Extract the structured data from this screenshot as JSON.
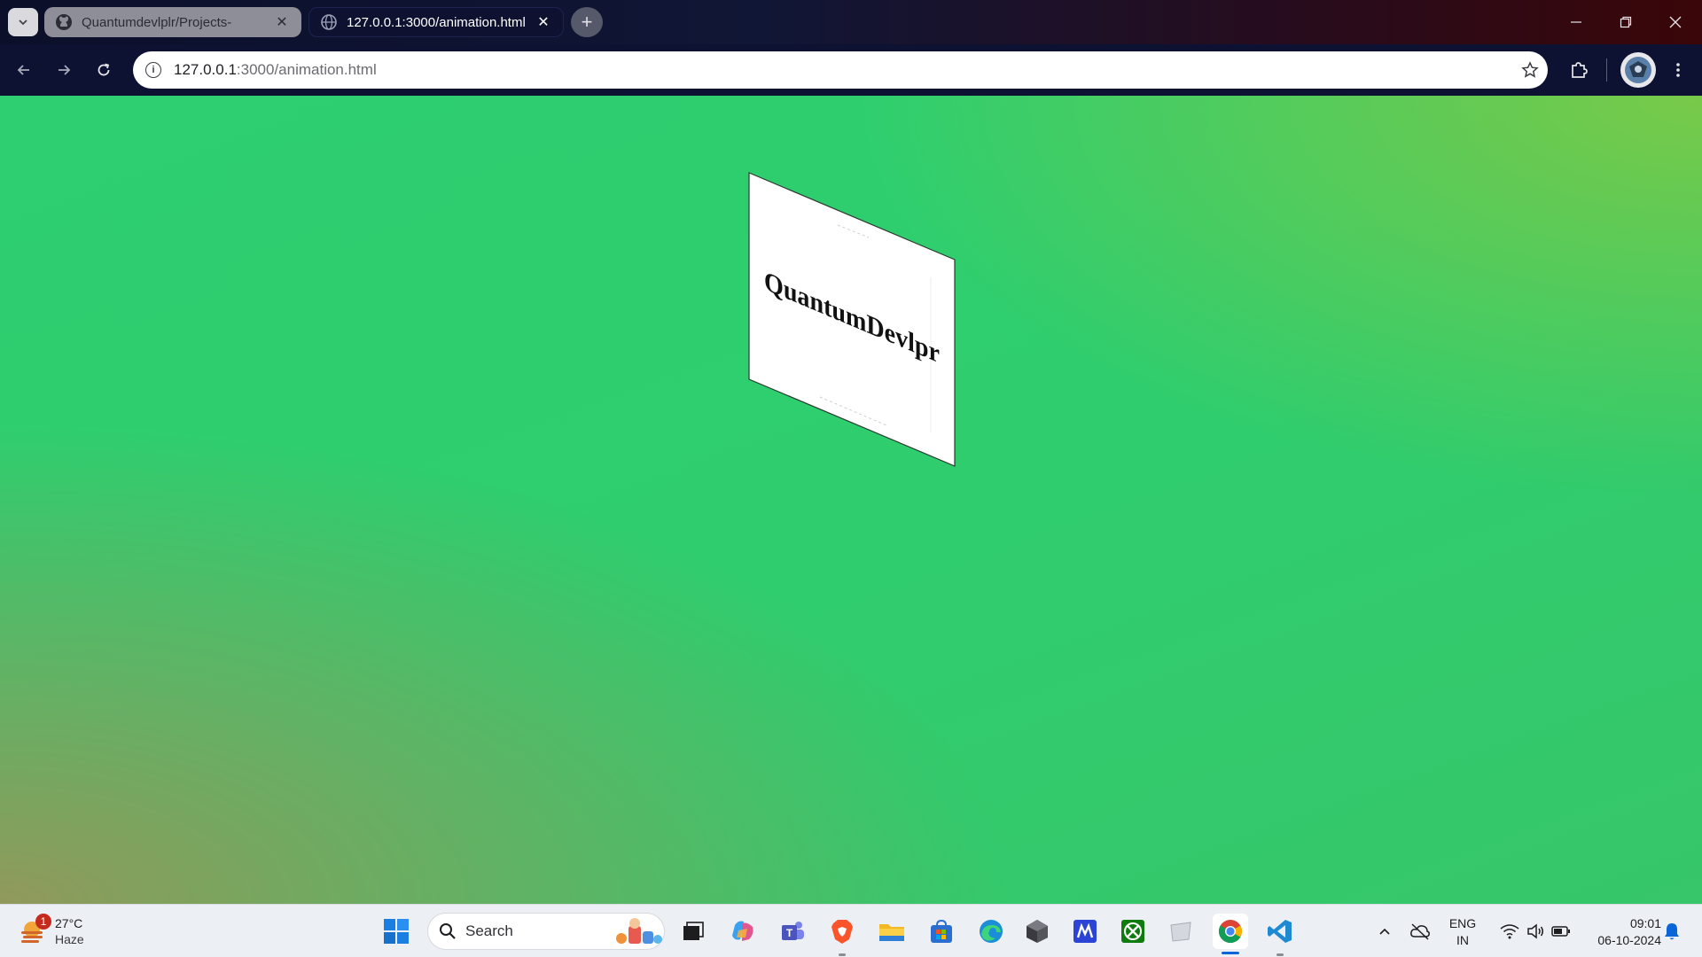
{
  "browser": {
    "tabs": [
      {
        "label": "Quantumdevlplr/Projects-",
        "favicon": "github-icon",
        "active": false
      },
      {
        "label": "127.0.0.1:3000/animation.html",
        "favicon": "globe-icon",
        "active": true
      }
    ],
    "address": {
      "host": "127.0.0.1",
      "rest": ":3000/animation.html"
    }
  },
  "page": {
    "card_text": "QuantumDevlpr",
    "colors": {
      "background_green": "#2ecf70",
      "card": "#ffffff",
      "text": "#111111"
    }
  },
  "taskbar": {
    "weather": {
      "temp": "27°C",
      "condition": "Haze",
      "badge": "1"
    },
    "search_placeholder": "Search",
    "tray": {
      "lang": "ENG",
      "region": "IN",
      "time": "09:01",
      "date": "06-10-2024"
    },
    "apps": [
      "windows-start-icon",
      "task-view-icon",
      "copilot-icon",
      "teams-icon",
      "brave-icon",
      "file-explorer-icon",
      "microsoft-store-icon",
      "edge-icon",
      "unity-icon",
      "app-m-icon",
      "xbox-icon",
      "app-tile-icon",
      "chrome-icon",
      "vscode-icon"
    ]
  }
}
